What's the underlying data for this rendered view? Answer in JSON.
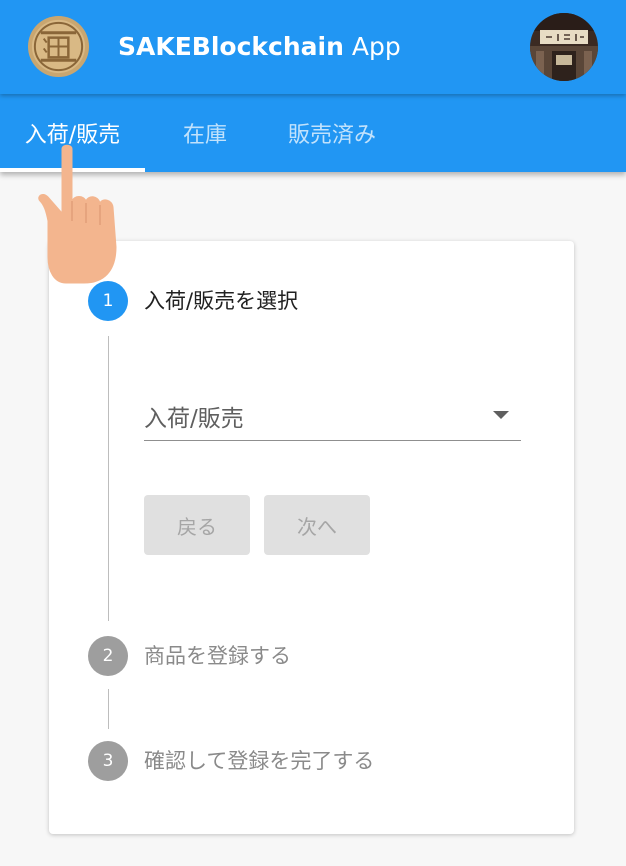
{
  "app": {
    "title_bold": "SAKEBlockchain",
    "title_rest": " App",
    "brand_color": "#2196f3"
  },
  "tabs": [
    {
      "label": "入荷/販売",
      "active": true
    },
    {
      "label": "在庫",
      "active": false
    },
    {
      "label": "販売済み",
      "active": false
    }
  ],
  "stepper": {
    "steps": [
      {
        "number": "1",
        "label": "入荷/販売を選択",
        "active": true
      },
      {
        "number": "2",
        "label": "商品を登録する",
        "active": false
      },
      {
        "number": "3",
        "label": "確認して登録を完了する",
        "active": false
      }
    ],
    "select": {
      "value": "入荷/販売"
    },
    "back_label": "戻る",
    "next_label": "次へ"
  },
  "icons": {
    "logo": "sake-logo-icon",
    "avatar": "user-avatar",
    "dropdown": "arrow-drop-down-icon",
    "pointer": "pointing-hand-icon"
  }
}
